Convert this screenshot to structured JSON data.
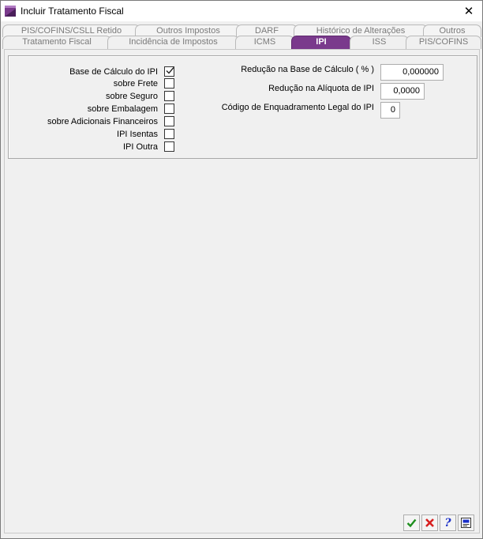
{
  "window": {
    "title": "Incluir Tratamento Fiscal",
    "close": "✕"
  },
  "tabs_back": [
    {
      "label": "PIS/COFINS/CSLL Retido"
    },
    {
      "label": "Outros Impostos"
    },
    {
      "label": "DARF"
    },
    {
      "label": "Histórico de Alterações"
    },
    {
      "label": "Outros"
    }
  ],
  "tabs_front": [
    {
      "label": "Tratamento Fiscal"
    },
    {
      "label": "Incidência de Impostos"
    },
    {
      "label": "ICMS"
    },
    {
      "label": "IPI"
    },
    {
      "label": "ISS"
    },
    {
      "label": "PIS/COFINS"
    }
  ],
  "active_tab": "IPI",
  "checkboxes": [
    {
      "label": "Base de Cálculo do IPI",
      "checked": true
    },
    {
      "label": "sobre Frete",
      "checked": false
    },
    {
      "label": "sobre Seguro",
      "checked": false
    },
    {
      "label": "sobre Embalagem",
      "checked": false
    },
    {
      "label": "sobre Adicionais Financeiros",
      "checked": false
    },
    {
      "label": "IPI Isentas",
      "checked": false
    },
    {
      "label": "IPI Outra",
      "checked": false
    }
  ],
  "fields": [
    {
      "label": "Redução na Base de Cálculo ( % )",
      "value": "0,000000"
    },
    {
      "label": "Redução na Alíquota de IPI",
      "value": "0,0000"
    },
    {
      "label": "Código de Enquadramento Legal do IPI",
      "value": "0"
    }
  ],
  "footer": {
    "ok_icon": "check-icon",
    "cancel_icon": "x-icon",
    "help_label": "?",
    "extra_icon": "document-icon"
  },
  "colors": {
    "active_tab": "#7a3a8c",
    "ok": "#1e8f1e",
    "cancel": "#d81e1e",
    "help": "#1a2fc8"
  }
}
